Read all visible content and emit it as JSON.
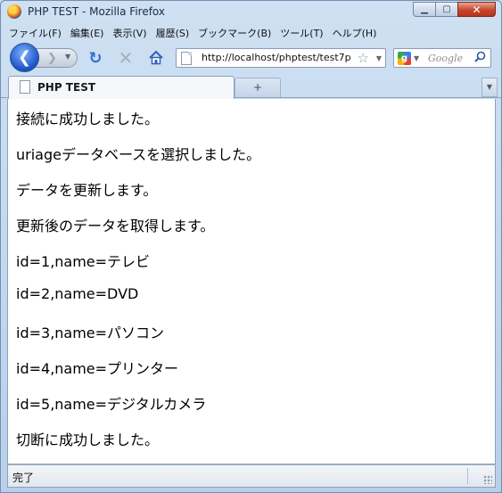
{
  "window": {
    "title": "PHP TEST - Mozilla Firefox"
  },
  "menubar": {
    "items": [
      "ファイル(F)",
      "編集(E)",
      "表示(V)",
      "履歴(S)",
      "ブックマーク(B)",
      "ツール(T)",
      "ヘルプ(H)"
    ]
  },
  "navbar": {
    "url": "http://localhost/phptest/test7p",
    "search_placeholder": "Google"
  },
  "tabs": [
    {
      "title": "PHP TEST"
    }
  ],
  "content": {
    "lines": [
      "接続に成功しました。",
      "uriageデータベースを選択しました。",
      "データを更新します。",
      "更新後のデータを取得します。",
      "id=1,name=テレビ",
      "id=2,name=DVD",
      "id=3,name=パソコン",
      "id=4,name=プリンター",
      "id=5,name=デジタルカメラ",
      "切断に成功しました。"
    ]
  },
  "statusbar": {
    "text": "完了"
  },
  "colors": {
    "chrome": "#c9dbee",
    "close_button": "#c7452c",
    "back_button": "#1f57c9"
  }
}
